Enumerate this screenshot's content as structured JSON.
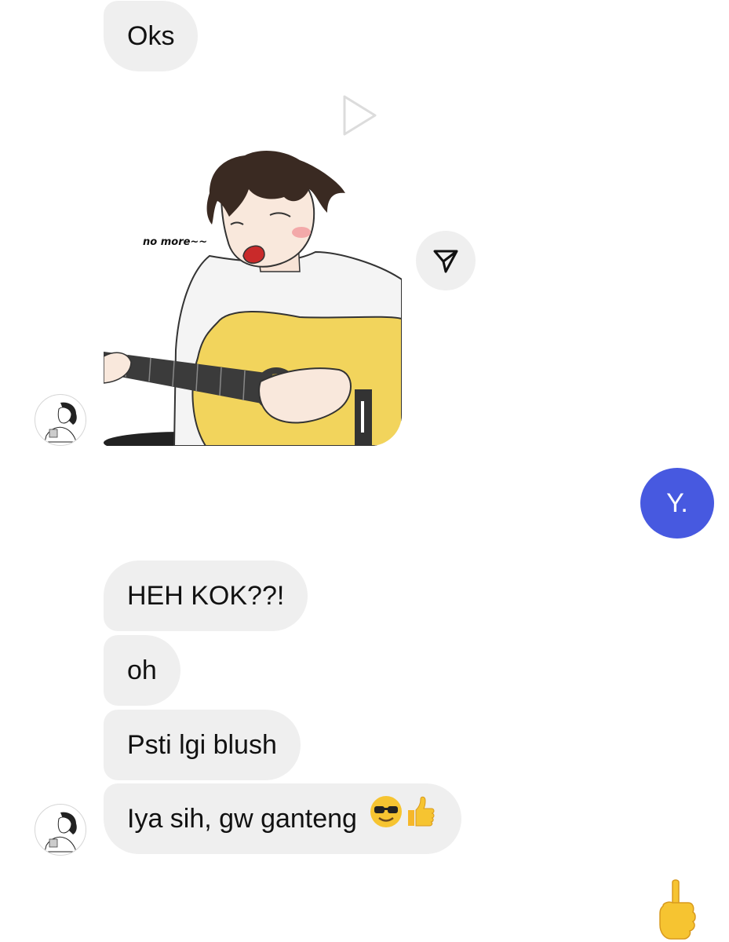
{
  "messages": {
    "m1": "Oks",
    "m2": "HEH KOK??!",
    "m3": "oh",
    "m4": "Psti lgi blush",
    "m5": "Iya sih, gw ganteng"
  },
  "sticker": {
    "caption": "no more~~"
  },
  "me": {
    "initial": "Y."
  },
  "icons": {
    "play": "play-icon",
    "share": "send-icon",
    "reaction": "pointing-up-emoji"
  },
  "colors": {
    "bubble": "#efefef",
    "my_avatar": "#4759e0",
    "guitar": "#f2d45c"
  }
}
